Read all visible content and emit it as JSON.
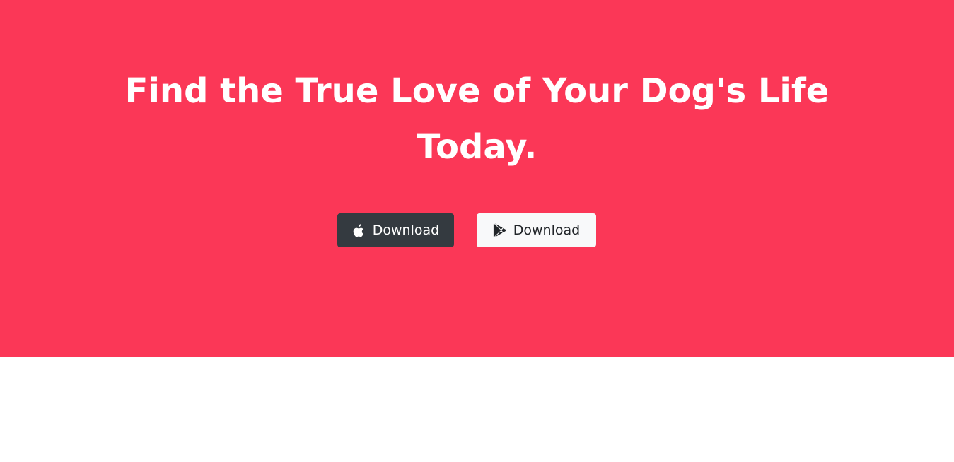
{
  "hero": {
    "background_color": "#fb3757",
    "headline": "Find the True Love of Your Dog's Life Today."
  },
  "buttons": {
    "apple": {
      "label": "Download",
      "icon": "apple-icon",
      "background_color": "#343a40"
    },
    "google_play": {
      "label": "Download",
      "icon": "google-play-icon",
      "background_color": "#f8f9fa"
    }
  }
}
